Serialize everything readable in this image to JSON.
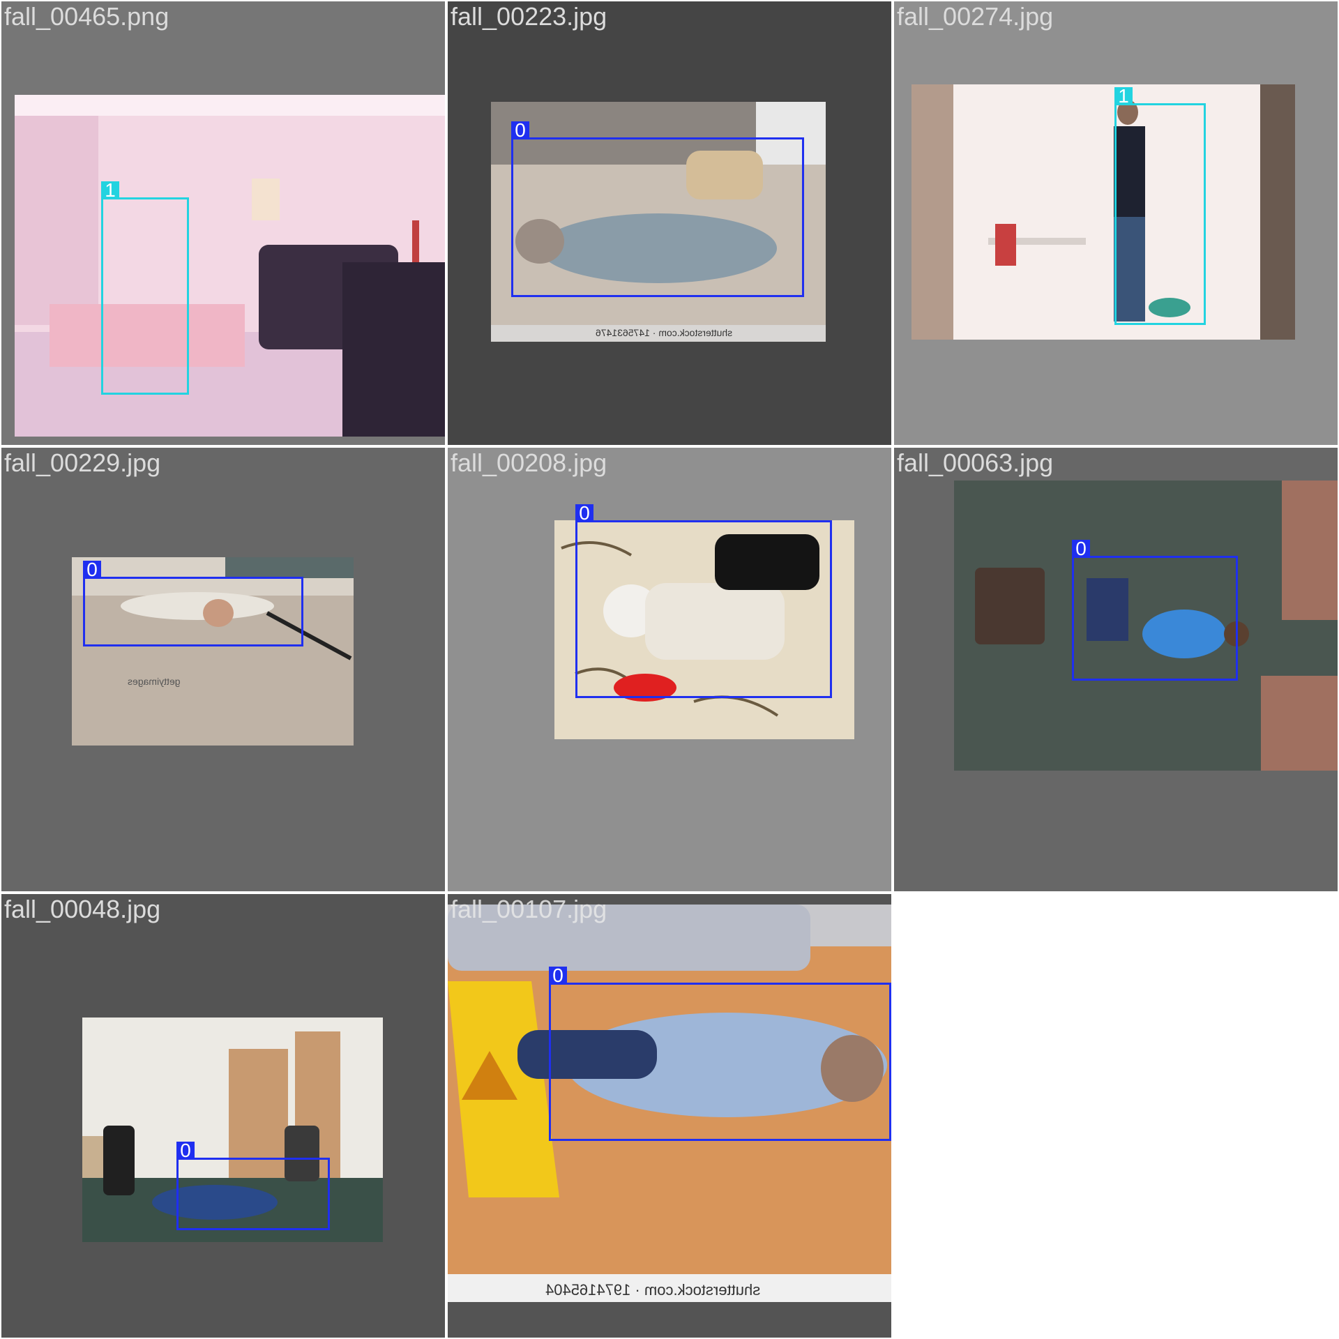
{
  "colors": {
    "class_0": "#1f2ff0",
    "class_1": "#22d3e0"
  },
  "tiles": [
    {
      "filename": "fall_00465.png",
      "boxes": [
        {
          "label": "1"
        }
      ]
    },
    {
      "filename": "fall_00223.jpg",
      "boxes": [
        {
          "label": "0"
        }
      ],
      "watermark": "shutterstock.com · 1475631476"
    },
    {
      "filename": "fall_00274.jpg",
      "boxes": [
        {
          "label": "1"
        }
      ]
    },
    {
      "filename": "fall_00229.jpg",
      "boxes": [
        {
          "label": "0"
        }
      ],
      "watermark": "gettyimages"
    },
    {
      "filename": "fall_00208.jpg",
      "boxes": [
        {
          "label": "0"
        }
      ]
    },
    {
      "filename": "fall_00063.jpg",
      "boxes": [
        {
          "label": "0"
        }
      ]
    },
    {
      "filename": "fall_00048.jpg",
      "boxes": [
        {
          "label": "0"
        }
      ]
    },
    {
      "filename": "fall_00107.jpg",
      "boxes": [
        {
          "label": "0"
        }
      ],
      "watermark": "shutterstock.com · 1974165404"
    }
  ]
}
